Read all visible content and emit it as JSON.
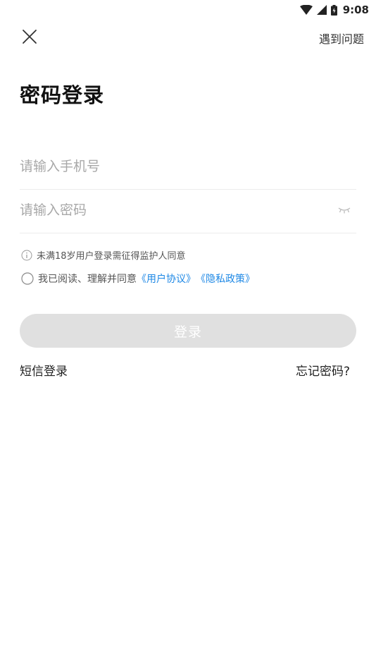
{
  "status_bar": {
    "time": "9:08",
    "icons": [
      "wifi-icon",
      "signal-icon",
      "battery-charging-icon"
    ]
  },
  "header": {
    "close_icon": "close-icon",
    "help_label": "遇到问题"
  },
  "page": {
    "title": "密码登录"
  },
  "form": {
    "phone_placeholder": "请输入手机号",
    "phone_value": "",
    "password_placeholder": "请输入密码",
    "password_value": "",
    "password_toggle_icon": "eye-closed-icon"
  },
  "notice": {
    "icon": "info-icon",
    "text": "未满18岁用户登录需征得监护人同意"
  },
  "agreement": {
    "text": "我已阅读、理解并同意",
    "user_agreement": "《用户协议》",
    "privacy_policy": "《隐私政策》",
    "checked": false
  },
  "actions": {
    "login_label": "登录",
    "sms_login_label": "短信登录",
    "forgot_password_label": "忘记密码?"
  },
  "colors": {
    "link": "#1e88e5",
    "button_disabled": "#e0e0e0",
    "divider": "#ececec"
  }
}
